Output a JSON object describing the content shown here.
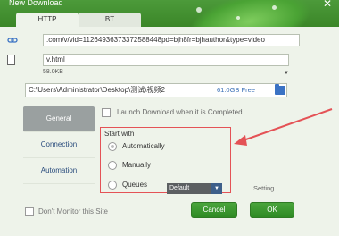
{
  "window": {
    "title": "New Download",
    "close_glyph": "✕"
  },
  "tabs": [
    {
      "label": "HTTP"
    },
    {
      "label": "BT"
    }
  ],
  "url_field": {
    "value": ".com/v/vid=11264936373372588448pd=bjh8fr=bjhauthor&type=video"
  },
  "filename_field": {
    "value": "v.html"
  },
  "size_text": "58.0KB",
  "save_path": {
    "path": "C:\\Users\\Administrator\\Desktop\\测试\\视频2",
    "free_space": "61.0GB Free"
  },
  "menu": [
    {
      "label": "General",
      "active": true
    },
    {
      "label": "Connection",
      "active": false
    },
    {
      "label": "Automation",
      "active": false
    }
  ],
  "launch_option": {
    "label": "Launch Download when it is Completed"
  },
  "start_with": {
    "label": "Start with",
    "options": [
      {
        "label": "Automatically",
        "checked": true
      },
      {
        "label": "Manually",
        "checked": false
      },
      {
        "label": "Queues",
        "checked": false
      }
    ],
    "queue_select": "Default"
  },
  "settings_link": "Setting...",
  "dont_monitor": {
    "label": "Don't Monitor this Site"
  },
  "buttons": {
    "cancel": "Cancel",
    "ok": "OK"
  },
  "colors": {
    "brand_green": "#3b8628",
    "highlight_red": "#e45256",
    "link_blue": "#3a6fb6"
  },
  "icons": {
    "url": "link-icon",
    "file": "file-icon",
    "folder": "folder-icon"
  }
}
